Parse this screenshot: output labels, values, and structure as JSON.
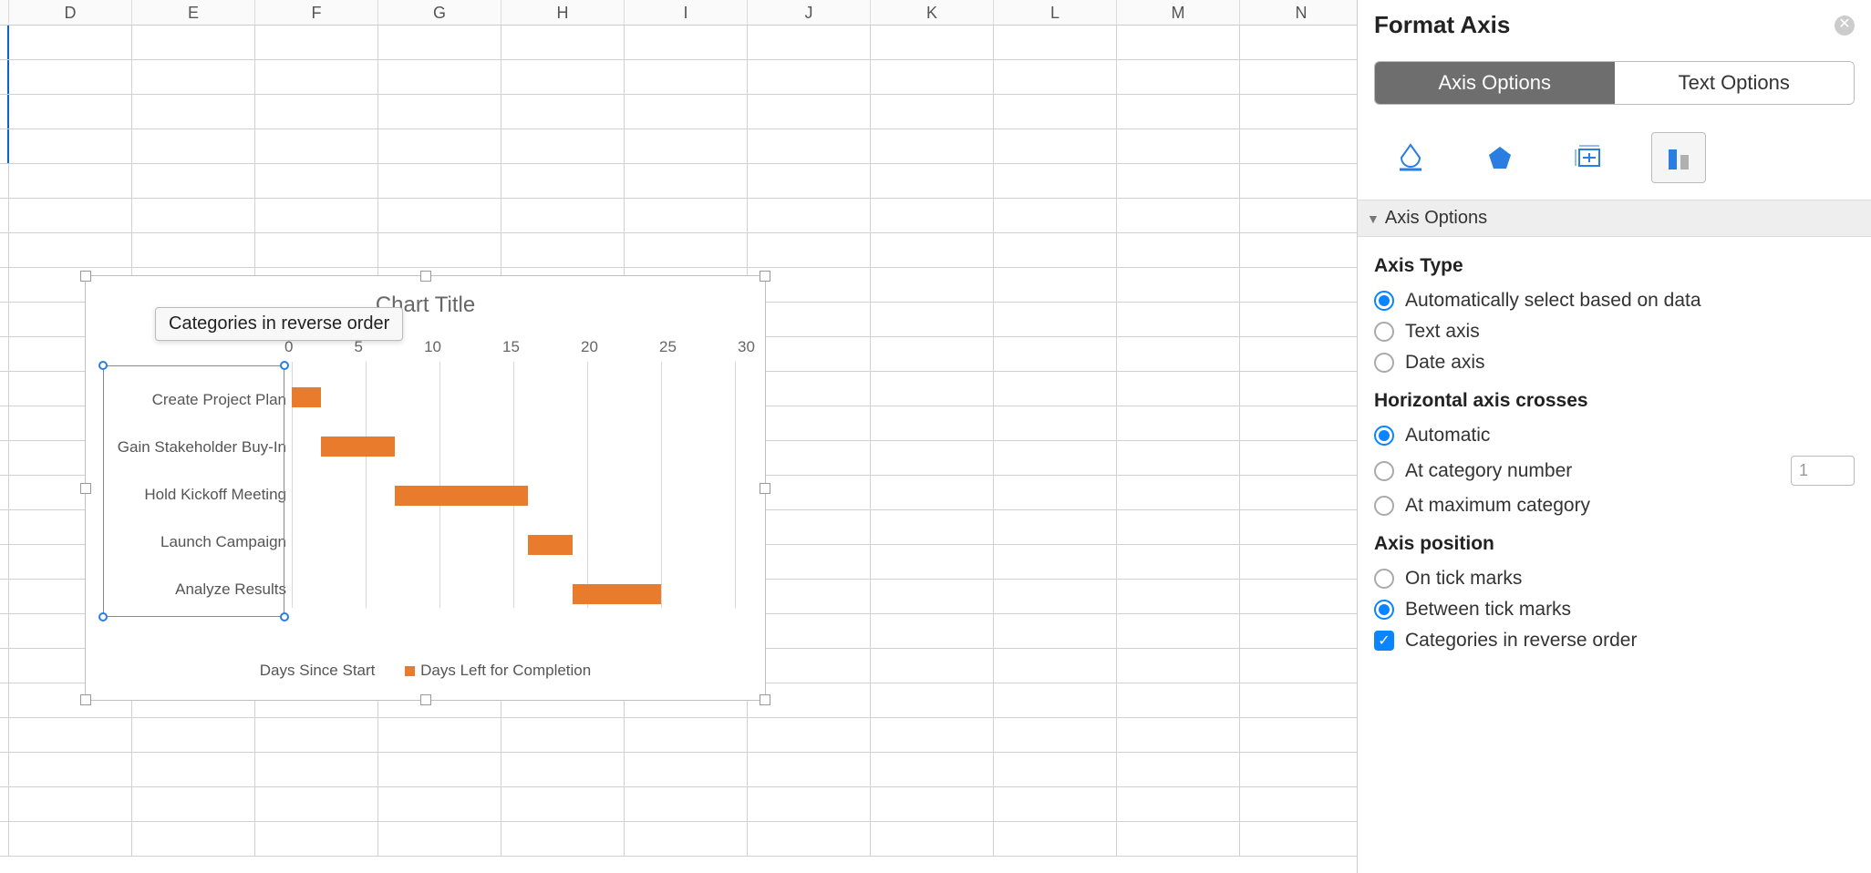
{
  "columns": [
    "D",
    "E",
    "F",
    "G",
    "H",
    "I",
    "J",
    "K",
    "L",
    "M",
    "N"
  ],
  "tooltip": "Categories in reverse order",
  "chart": {
    "title": "Chart Title",
    "ticks": [
      "0",
      "5",
      "10",
      "15",
      "20",
      "25",
      "30"
    ],
    "categories": [
      "Create Project Plan",
      "Gain Stakeholder Buy-In",
      "Hold Kickoff Meeting",
      "Launch Campaign",
      "Analyze Results"
    ],
    "legend": {
      "s1": "Days Since Start",
      "s2": "Days Left for Completion"
    }
  },
  "chart_data": {
    "type": "bar",
    "orientation": "horizontal",
    "stacked": true,
    "title": "Chart Title",
    "xlabel": "",
    "ylabel": "",
    "xlim": [
      0,
      30
    ],
    "categories": [
      "Create Project Plan",
      "Gain Stakeholder Buy-In",
      "Hold Kickoff Meeting",
      "Launch Campaign",
      "Analyze Results"
    ],
    "series": [
      {
        "name": "Days Since Start",
        "values": [
          0,
          2,
          7,
          16,
          19
        ],
        "color": "transparent"
      },
      {
        "name": "Days Left for Completion",
        "values": [
          2,
          5,
          9,
          3,
          6
        ],
        "color": "#e87c2c"
      }
    ],
    "xticks": [
      0,
      5,
      10,
      15,
      20,
      25,
      30
    ]
  },
  "pane": {
    "title": "Format Axis",
    "tabs": {
      "axis": "Axis Options",
      "text": "Text Options"
    },
    "section": "Axis Options",
    "axis_type": {
      "title": "Axis Type",
      "auto": "Automatically select based on data",
      "text": "Text axis",
      "date": "Date axis"
    },
    "haxis": {
      "title": "Horizontal axis crosses",
      "auto": "Automatic",
      "cat": "At category number",
      "cat_value": "1",
      "max": "At maximum category"
    },
    "apos": {
      "title": "Axis position",
      "ticks": "On tick marks",
      "between": "Between tick marks",
      "reverse": "Categories in reverse order"
    }
  }
}
